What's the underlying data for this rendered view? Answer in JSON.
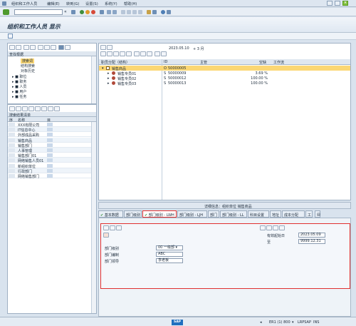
{
  "menu": {
    "items": [
      "组织和工作人员",
      "编辑(E)",
      "转到(G)",
      "设置(S)",
      "系统(Y)",
      "帮助(H)"
    ]
  },
  "toolbar": {
    "command_value": "",
    "back_symbol": "«"
  },
  "title": "组织和工作人员 显示",
  "left_panel": {
    "header": "查找根据",
    "tree": [
      {
        "label": "搜索词",
        "level": 2,
        "selected": true
      },
      {
        "label": "结构搜索",
        "level": 2
      },
      {
        "label": "对象历史",
        "level": 2
      },
      {
        "label": "职位",
        "level": 1
      },
      {
        "label": "职务",
        "level": 1
      },
      {
        "label": "人员",
        "level": 1
      },
      {
        "label": "用户",
        "level": 1
      },
      {
        "label": "任务",
        "level": 1
      }
    ],
    "result_title": "搜索结果清单",
    "result_cols": [
      "序",
      "名称",
      "目"
    ],
    "results": [
      "XXX有限公司",
      "IT信息中心",
      "外部成品采购",
      "销售商品",
      "销售部门",
      "人事管理",
      "销售部门01",
      "网络销售人员01",
      "新组织单位",
      "行政部门",
      "网络销售部门"
    ]
  },
  "right_panel": {
    "date": "2023.05.10",
    "period": "+ 3 月",
    "columns": [
      "职员分配（结构）",
      "ID",
      "主管",
      "空缺",
      "工作流"
    ],
    "rows": [
      {
        "name": "销售商品",
        "type": "O",
        "id": "50000005",
        "pct": "",
        "selected": true
      },
      {
        "name": "销售专员01",
        "type": "S",
        "id": "50000009",
        "pct": "3.69 %"
      },
      {
        "name": "销售专员02",
        "type": "S",
        "id": "50000012",
        "pct": "100.00 %"
      },
      {
        "name": "销售专员03",
        "type": "S",
        "id": "50000013",
        "pct": "100.00 %"
      }
    ]
  },
  "detail_header": "详细信息：组织单位 销售商品",
  "tabs": [
    {
      "label": "基本数据",
      "checked": true
    },
    {
      "label": "部门级别"
    },
    {
      "label": "部门级别 - LWH",
      "checked": true,
      "active": true
    },
    {
      "label": "部门级别 - LJH"
    },
    {
      "label": "部门"
    },
    {
      "label": "部门级别 - LL"
    },
    {
      "label": "科目设置"
    },
    {
      "label": "地址"
    },
    {
      "label": "成本分配"
    },
    {
      "label": "工"
    }
  ],
  "detail": {
    "valid_from_label": "有效起始日",
    "valid_from": "2023.05.09",
    "to_label": "至",
    "valid_to": "9999.12.31",
    "fields": [
      {
        "label": "部门级别",
        "value": "00 一级部"
      },
      {
        "label": "部门编制",
        "value": "ABC"
      },
      {
        "label": "部门领导",
        "value": "李老板"
      }
    ]
  },
  "status": {
    "logo": "SAP",
    "system": "ER1 (1) 800",
    "server": "LRPSAP",
    "mode": "INS"
  }
}
